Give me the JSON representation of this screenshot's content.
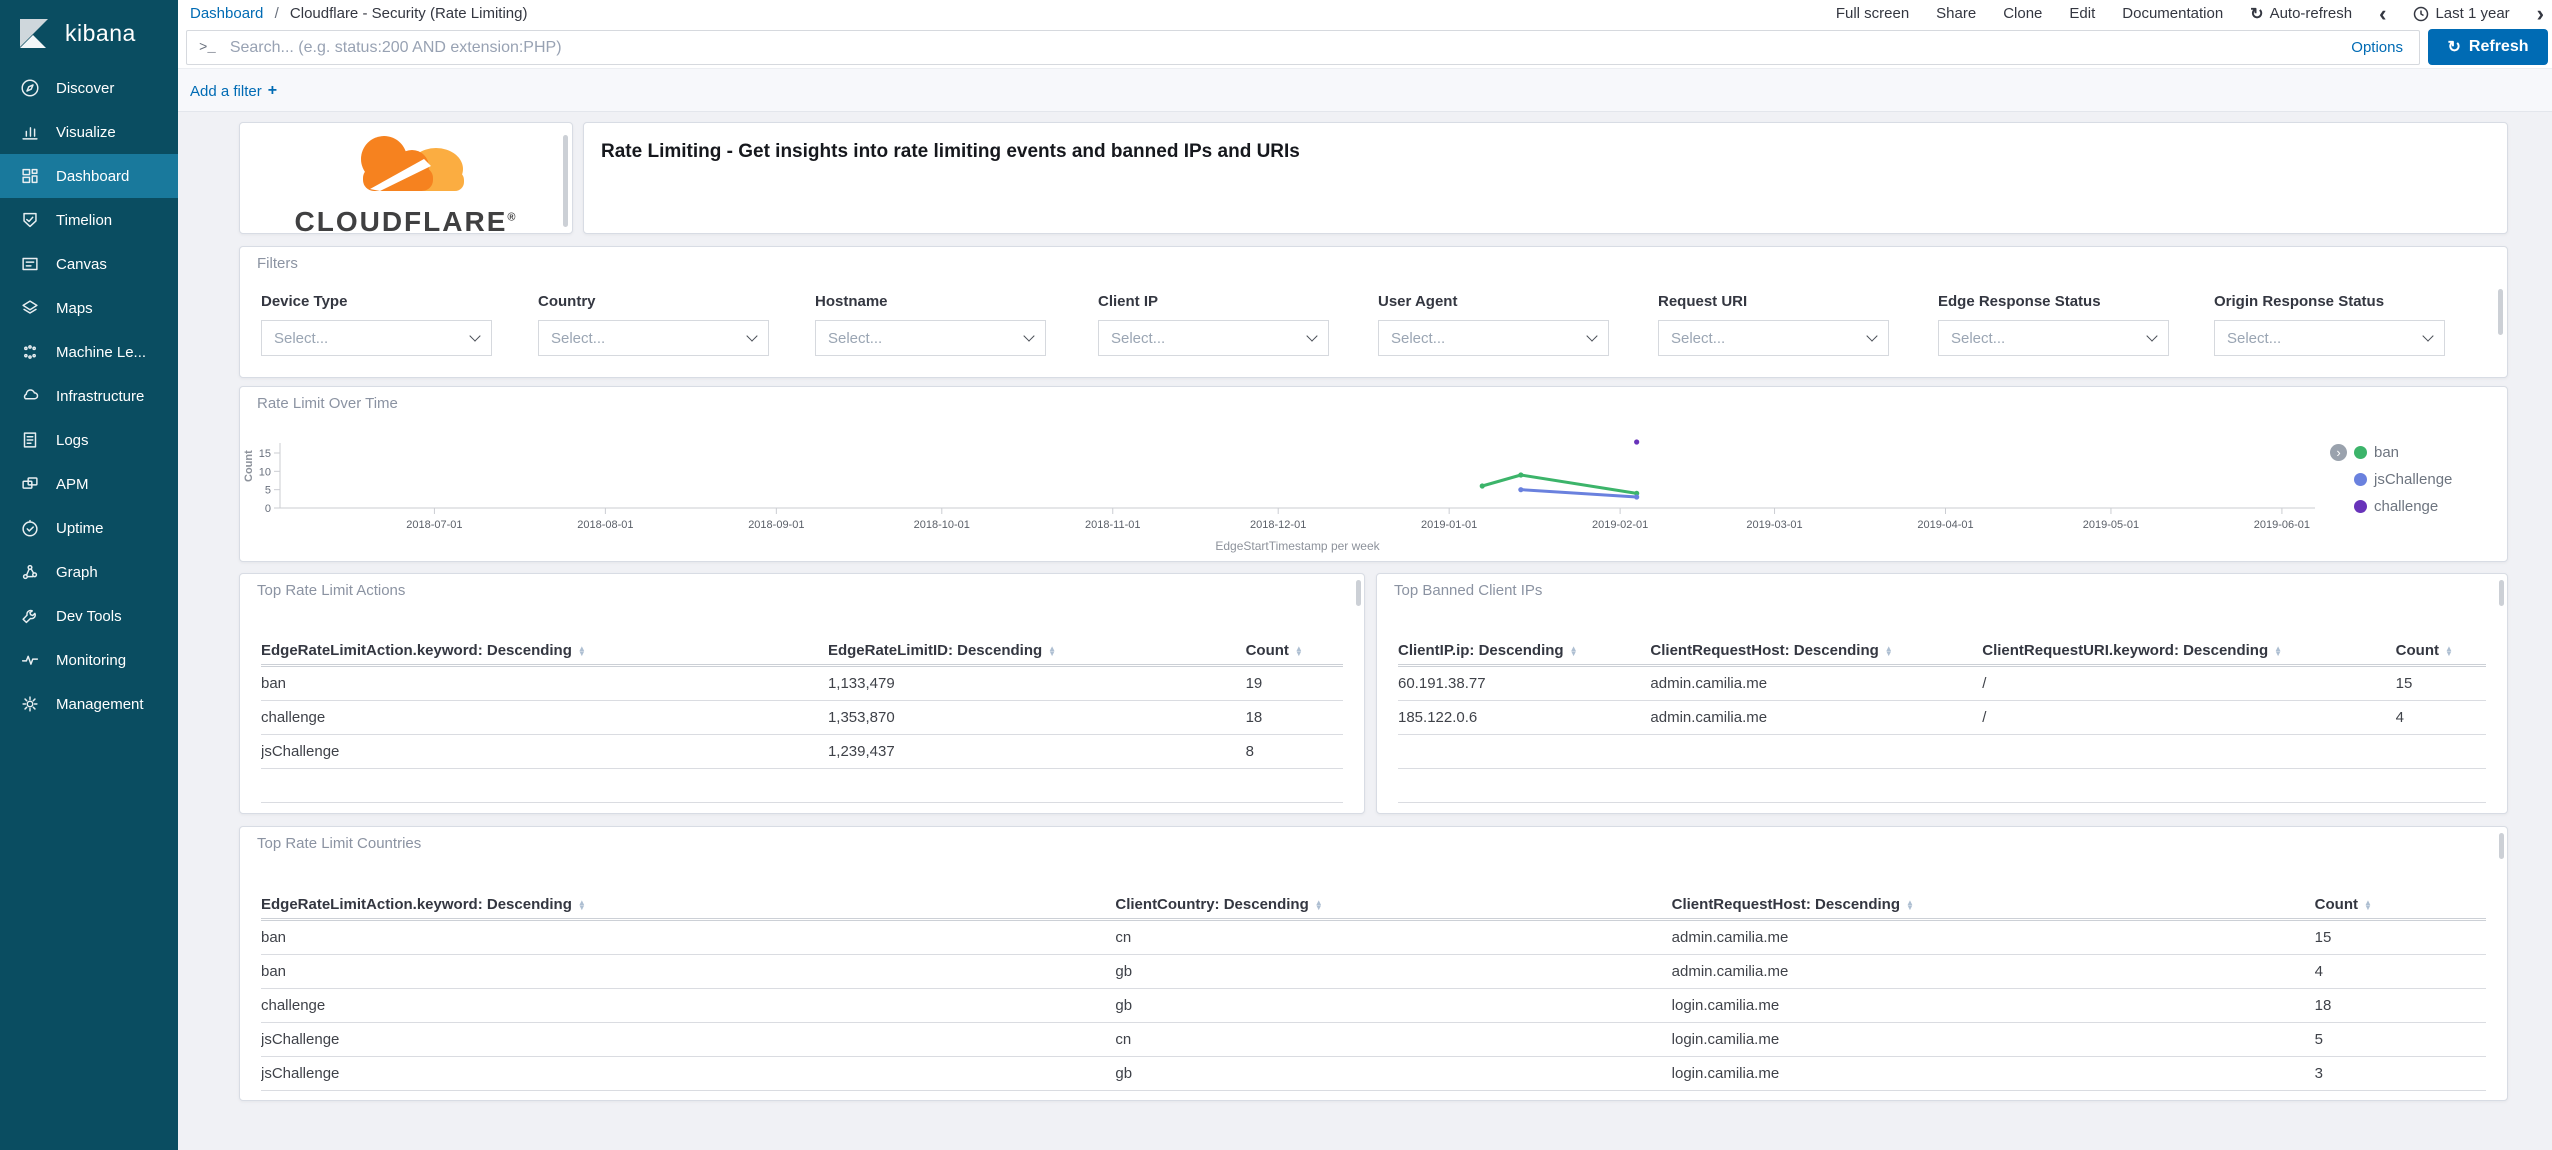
{
  "sidebar": {
    "logo_text": "kibana",
    "items": [
      {
        "label": "Discover",
        "icon": "discover-icon",
        "selected": false
      },
      {
        "label": "Visualize",
        "icon": "visualize-icon",
        "selected": false
      },
      {
        "label": "Dashboard",
        "icon": "dashboard-icon",
        "selected": true
      },
      {
        "label": "Timelion",
        "icon": "timelion-icon",
        "selected": false
      },
      {
        "label": "Canvas",
        "icon": "canvas-icon",
        "selected": false
      },
      {
        "label": "Maps",
        "icon": "maps-icon",
        "selected": false
      },
      {
        "label": "Machine Le...",
        "icon": "machine-learning-icon",
        "selected": false
      },
      {
        "label": "Infrastructure",
        "icon": "infrastructure-icon",
        "selected": false
      },
      {
        "label": "Logs",
        "icon": "logs-icon",
        "selected": false
      },
      {
        "label": "APM",
        "icon": "apm-icon",
        "selected": false
      },
      {
        "label": "Uptime",
        "icon": "uptime-icon",
        "selected": false
      },
      {
        "label": "Graph",
        "icon": "graph-icon",
        "selected": false
      },
      {
        "label": "Dev Tools",
        "icon": "dev-tools-icon",
        "selected": false
      },
      {
        "label": "Monitoring",
        "icon": "monitoring-icon",
        "selected": false
      },
      {
        "label": "Management",
        "icon": "management-icon",
        "selected": false
      }
    ]
  },
  "breadcrumb": {
    "root": "Dashboard",
    "separator": "/",
    "current": "Cloudflare - Security (Rate Limiting)"
  },
  "top_menu": {
    "items": [
      "Full screen",
      "Share",
      "Clone",
      "Edit",
      "Documentation"
    ],
    "auto_refresh_label": "Auto-refresh",
    "prev_icon": "‹",
    "time_range_label": "Last 1 year",
    "next_icon": "›"
  },
  "query_bar": {
    "placeholder": "Search... (e.g. status:200 AND extension:PHP)",
    "prompt": ">_",
    "options_label": "Options",
    "refresh_icon": "↻",
    "refresh_label": "Refresh"
  },
  "filter_bar": {
    "add_filter_label": "Add a filter",
    "plus": "+"
  },
  "panels": {
    "logo": {
      "brand": "CLOUDFLARE",
      "registered_mark": "®"
    },
    "markdown": {
      "text": "Rate Limiting - Get insights into rate limiting events and banned IPs and URIs"
    },
    "filters": {
      "title": "Filters",
      "select_placeholder": "Select...",
      "fields": [
        "Device Type",
        "Country",
        "Hostname",
        "Client IP",
        "User Agent",
        "Request URI",
        "Edge Response Status",
        "Origin Response Status"
      ]
    },
    "chart": {
      "title": "Rate Limit Over Time"
    },
    "actions_table": {
      "title": "Top Rate Limit Actions",
      "columns": [
        "EdgeRateLimitAction.keyword: Descending",
        "EdgeRateLimitID: Descending",
        "Count"
      ],
      "rows": [
        [
          "ban",
          "1,133,479",
          "19"
        ],
        [
          "challenge",
          "1,353,870",
          "18"
        ],
        [
          "jsChallenge",
          "1,239,437",
          "8"
        ]
      ]
    },
    "banned_table": {
      "title": "Top Banned Client IPs",
      "columns": [
        "ClientIP.ip: Descending",
        "ClientRequestHost: Descending",
        "ClientRequestURI.keyword: Descending",
        "Count"
      ],
      "rows": [
        [
          "60.191.38.77",
          "admin.camilia.me",
          "/",
          "15"
        ],
        [
          "185.122.0.6",
          "admin.camilia.me",
          "/",
          "4"
        ]
      ]
    },
    "countries_table": {
      "title": "Top Rate Limit Countries",
      "columns": [
        "EdgeRateLimitAction.keyword: Descending",
        "ClientCountry: Descending",
        "ClientRequestHost: Descending",
        "Count"
      ],
      "rows": [
        [
          "ban",
          "cn",
          "admin.camilia.me",
          "15"
        ],
        [
          "ban",
          "gb",
          "admin.camilia.me",
          "4"
        ],
        [
          "challenge",
          "gb",
          "login.camilia.me",
          "18"
        ],
        [
          "jsChallenge",
          "cn",
          "login.camilia.me",
          "5"
        ],
        [
          "jsChallenge",
          "gb",
          "login.camilia.me",
          "3"
        ]
      ]
    }
  },
  "chart_data": {
    "type": "line",
    "title": "Rate Limit Over Time",
    "xlabel": "EdgeStartTimestamp per week",
    "ylabel": "Count",
    "y_ticks": [
      0,
      5,
      10,
      15
    ],
    "ylim": [
      0,
      15
    ],
    "grid": false,
    "legend_position": "right",
    "x_ticks": [
      "2018-07-01",
      "2018-08-01",
      "2018-09-01",
      "2018-10-01",
      "2018-11-01",
      "2018-12-01",
      "2019-01-01",
      "2019-02-01",
      "2019-03-01",
      "2019-04-01",
      "2019-05-01",
      "2019-06-01"
    ],
    "x_range": [
      "2018-06-03",
      "2019-06-07"
    ],
    "series": [
      {
        "name": "ban",
        "color": "#3CB46A",
        "points": [
          [
            "2019-01-07",
            6
          ],
          [
            "2019-01-14",
            9
          ],
          [
            "2019-02-04",
            4
          ]
        ]
      },
      {
        "name": "jsChallenge",
        "color": "#6A81DE",
        "points": [
          [
            "2019-01-14",
            5
          ],
          [
            "2019-02-04",
            3
          ]
        ]
      },
      {
        "name": "challenge",
        "color": "#6833BA",
        "points": [
          [
            "2019-02-04",
            18
          ]
        ]
      }
    ]
  },
  "colors": {
    "accent_blue": "#006BB4",
    "sidebar_bg": "#0a4d61",
    "sidebar_selected": "#19799c",
    "cloudflare_orange": "#F6821F",
    "cloudflare_light_orange": "#FBAD41",
    "ban_green": "#3CB46A",
    "jschallenge_blue": "#6A81DE",
    "challenge_purple": "#6833BA"
  }
}
